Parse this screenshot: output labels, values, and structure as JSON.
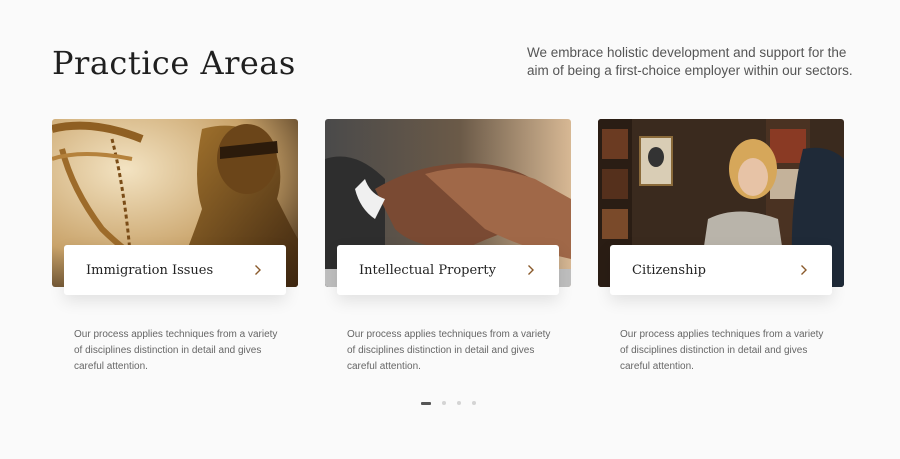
{
  "header": {
    "title": "Practice Areas",
    "intro": "We embrace holistic development and support for the aim of being a first-choice employer within our sectors."
  },
  "cards": [
    {
      "label": "Immigration Issues",
      "description": "Our process applies techniques from a variety of disciplines distinction in detail and gives careful attention.",
      "image_icon": "lady-justice-statue-image",
      "chevron_icon": "chevron-right-icon"
    },
    {
      "label": "Intellectual Property",
      "description": "Our process applies techniques from a variety of disciplines distinction in detail and gives careful attention.",
      "image_icon": "handshake-image",
      "chevron_icon": "chevron-right-icon"
    },
    {
      "label": "Citizenship",
      "description": "Our process applies techniques from a variety of disciplines distinction in detail and gives careful attention.",
      "image_icon": "office-meeting-image",
      "chevron_icon": "chevron-right-icon"
    }
  ],
  "carousel": {
    "total_pages": 4,
    "active_page": 1
  },
  "colors": {
    "accent": "#8a5a2b",
    "background": "#fafafa",
    "title": "#1f1f1f"
  }
}
